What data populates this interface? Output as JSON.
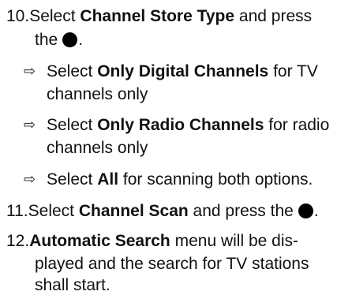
{
  "steps": [
    {
      "number": "10.",
      "pre": "Select ",
      "bold": "Channel Store Type",
      "post": " and press",
      "line2_pre": "the",
      "line2_post": "."
    },
    {
      "number": "11.",
      "pre": "Select ",
      "bold": "Channel Scan",
      "post": " and press the",
      "end": "."
    },
    {
      "number": "12.",
      "bold": "Automatic Search",
      "post": " menu will be dis-",
      "line2": "played and the search for TV stations",
      "line3": "shall start."
    }
  ],
  "bullets": [
    {
      "arrow": "⇨",
      "pre": "Select ",
      "bold": "Only Digital Channels",
      "post": " for TV",
      "line2": "channels only"
    },
    {
      "arrow": "⇨",
      "pre": "Select ",
      "bold": "Only Radio Channels",
      "post": " for radio",
      "line2": "channels only"
    },
    {
      "arrow": "⇨",
      "pre": "Select ",
      "bold": "All",
      "post": " for scanning both options."
    }
  ],
  "icons": {
    "button": "filled-circle-ok-button"
  }
}
